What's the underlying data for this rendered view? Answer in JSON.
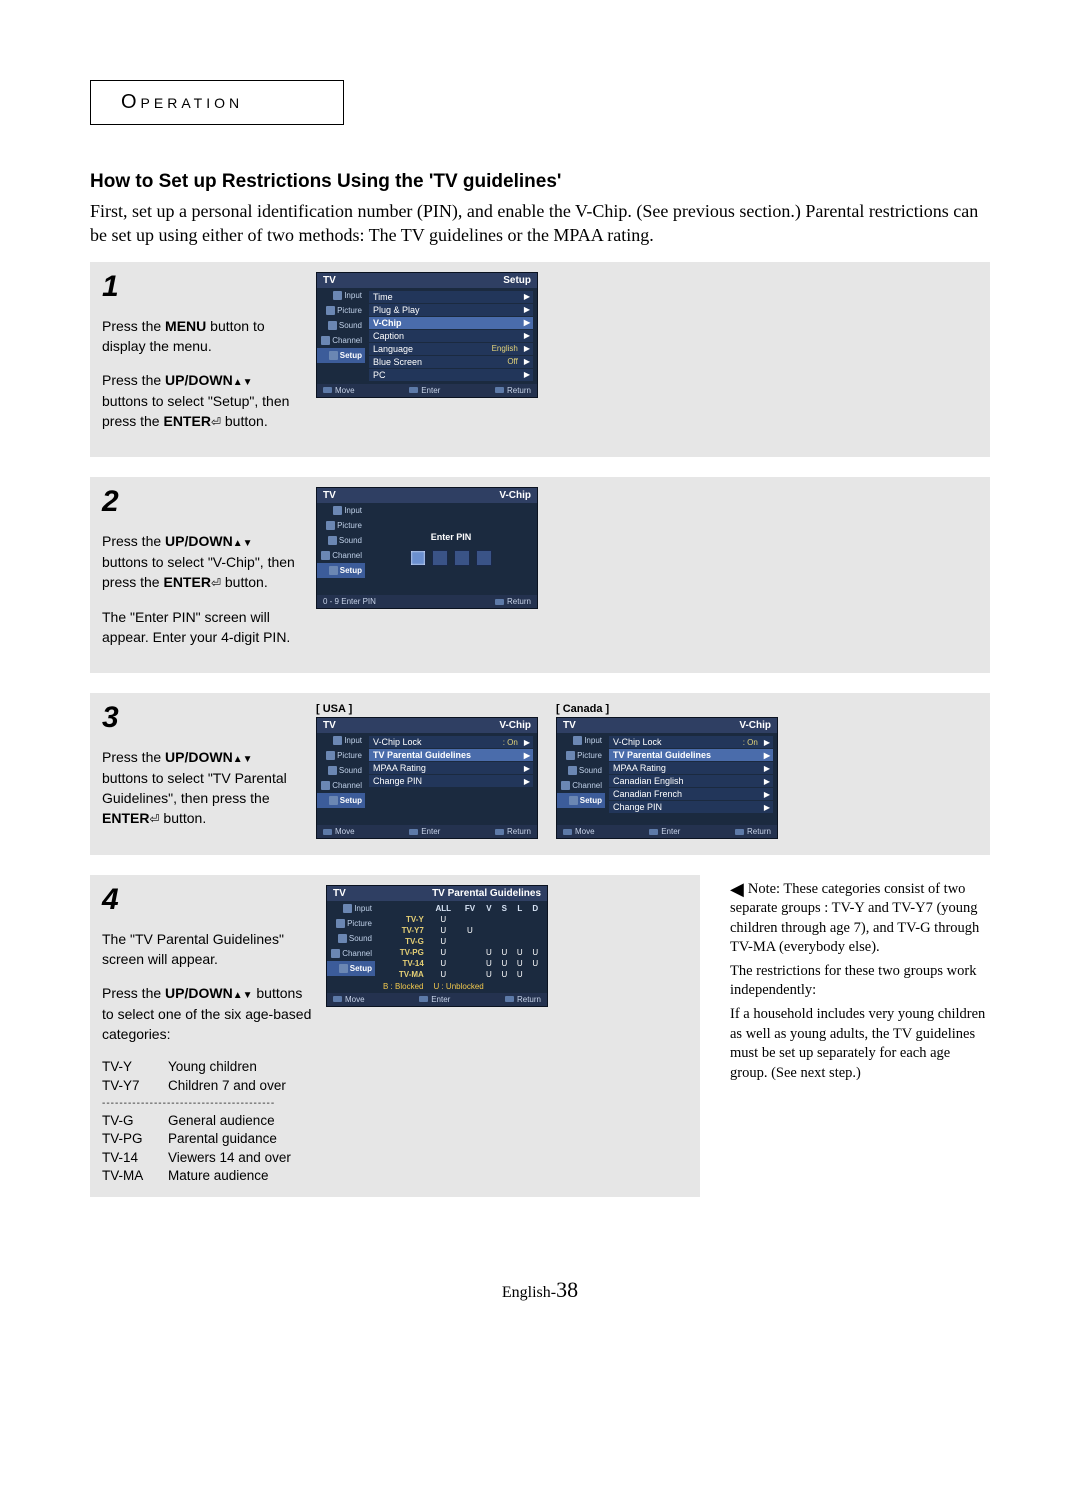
{
  "header": {
    "title": "Operation"
  },
  "section_title": "How to Set up Restrictions Using the 'TV guidelines'",
  "intro": "First, set up a personal identification number (PIN), and enable the V-Chip. (See previous section.) Parental restrictions can be set up using either of two methods: The TV guidelines or the MPAA rating.",
  "steps": {
    "s1": {
      "num": "1",
      "p1a": "Press the ",
      "p1b": "MENU",
      "p1c": " button to display the menu.",
      "p2a": "Press the ",
      "p2b": "UP/DOWN",
      "p2c": " buttons to select \"Setup\", then press the ",
      "p2d": "ENTER",
      "p2e": " button."
    },
    "s2": {
      "num": "2",
      "p1a": "Press the ",
      "p1b": "UP/DOWN",
      "p1c": " buttons to select \"V-Chip\", then press the ",
      "p1d": "ENTER",
      "p1e": " button.",
      "p2": "The \"Enter PIN\" screen will appear. Enter your 4-digit PIN."
    },
    "s3": {
      "num": "3",
      "p1a": "Press the ",
      "p1b": "UP/DOWN",
      "p1c": " buttons to select \"TV Parental Guidelines\", then press the ",
      "p1d": "ENTER",
      "p1e": " button."
    },
    "s4": {
      "num": "4",
      "p1": "The \"TV Parental Guidelines\" screen will appear.",
      "p2a": "Press the ",
      "p2b": "UP/DOWN",
      "p2c": " buttons to select one of the six age-based categories:"
    }
  },
  "ratings": {
    "divider": "----------------------------------------",
    "r1c": "TV-Y",
    "r1d": "Young children",
    "r2c": "TV-Y7",
    "r2d": "Children 7 and over",
    "r3c": "TV-G",
    "r3d": "General audience",
    "r4c": "TV-PG",
    "r4d": "Parental guidance",
    "r5c": "TV-14",
    "r5d": "Viewers 14 and over",
    "r6c": "TV-MA",
    "r6d": "Mature audience"
  },
  "note": {
    "text": "Note: These categories consist of two separate groups : TV-Y and TV-Y7 (young children through age 7), and TV-G through TV-MA (everybody else).",
    "text2": "The restrictions for these two groups work independently:",
    "text3": "If a household includes very young children as well as young adults, the TV guidelines must be set up separately for each age group. (See next step.)"
  },
  "footer": {
    "label": "English-",
    "page": "38"
  },
  "osd": {
    "tv_label": "TV",
    "side": {
      "input": "Input",
      "picture": "Picture",
      "sound": "Sound",
      "channel": "Channel",
      "setup": "Setup"
    },
    "foot": {
      "move": "Move",
      "enter": "Enter",
      "return": "Return",
      "pin_hint": "0 - 9 Enter PIN"
    },
    "screen1": {
      "title": "Setup",
      "rows": {
        "time": "Time",
        "plug": "Plug & Play",
        "vchip": "V-Chip",
        "caption": "Caption",
        "language": "Language",
        "language_val": "English",
        "blue": "Blue Screen",
        "blue_val": "Off",
        "pc": "PC"
      }
    },
    "screen2": {
      "title": "V-Chip",
      "enter_pin": "Enter PIN"
    },
    "labels": {
      "usa": "[ USA ]",
      "canada": "[ Canada ]"
    },
    "screen3_us": {
      "title": "V-Chip",
      "rows": {
        "lock": "V-Chip Lock",
        "lock_val": ": On",
        "tvpg": "TV Parental Guidelines",
        "mpaa": "MPAA Rating",
        "change": "Change PIN"
      }
    },
    "screen3_ca": {
      "title": "V-Chip",
      "rows": {
        "lock": "V-Chip Lock",
        "lock_val": ": On",
        "tvpg": "TV Parental Guidelines",
        "mpaa": "MPAA Rating",
        "ce": "Canadian English",
        "cf": "Canadian French",
        "change": "Change PIN"
      }
    },
    "screen4": {
      "title": "TV Parental Guidelines",
      "legend_b": "B : Blocked",
      "legend_u": "U : Unblocked",
      "cols": {
        "all": "ALL",
        "fv": "FV",
        "v": "V",
        "s": "S",
        "l": "L",
        "d": "D"
      },
      "rows": {
        "tvy": {
          "name": "TV-Y",
          "all": "U",
          "fv": "",
          "v": "",
          "s": "",
          "l": "",
          "d": ""
        },
        "tvy7": {
          "name": "TV-Y7",
          "all": "U",
          "fv": "U",
          "v": "",
          "s": "",
          "l": "",
          "d": ""
        },
        "tvg": {
          "name": "TV-G",
          "all": "U",
          "fv": "",
          "v": "",
          "s": "",
          "l": "",
          "d": ""
        },
        "tvpg": {
          "name": "TV-PG",
          "all": "U",
          "fv": "",
          "v": "U",
          "s": "U",
          "l": "U",
          "d": "U"
        },
        "tv14": {
          "name": "TV-14",
          "all": "U",
          "fv": "",
          "v": "U",
          "s": "U",
          "l": "U",
          "d": "U"
        },
        "tvma": {
          "name": "TV-MA",
          "all": "U",
          "fv": "",
          "v": "U",
          "s": "U",
          "l": "U",
          "d": ""
        }
      }
    }
  }
}
